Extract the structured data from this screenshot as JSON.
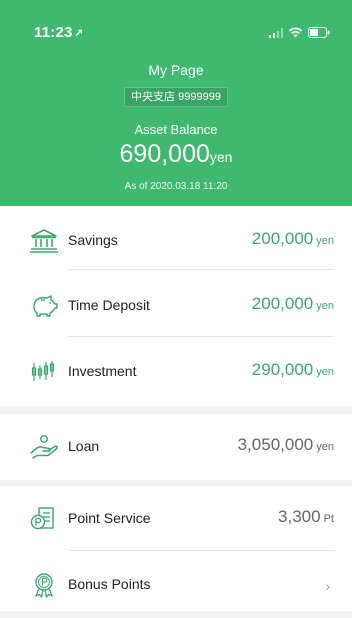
{
  "status": {
    "time": "11:23"
  },
  "header": {
    "title": "My Page",
    "branch": "中央支店 9999999",
    "asset_label": "Asset Balance",
    "asset_amount": "690,000",
    "asset_unit": "yen",
    "as_of": "As of 2020.03.18 11:20"
  },
  "accounts": [
    {
      "label": "Savings",
      "amount": "200,000",
      "unit": "yen"
    },
    {
      "label": "Time Deposit",
      "amount": "200,000",
      "unit": "yen"
    },
    {
      "label": "Investment",
      "amount": "290,000",
      "unit": "yen"
    }
  ],
  "loan": {
    "label": "Loan",
    "amount": "3,050,000",
    "unit": "yen"
  },
  "points": [
    {
      "label": "Point Service",
      "amount": "3,300",
      "unit": "Pt"
    },
    {
      "label": "Bonus Points",
      "chevron": "›"
    }
  ],
  "colors": {
    "brand": "#3fb870",
    "value_green": "#3aa86d"
  }
}
